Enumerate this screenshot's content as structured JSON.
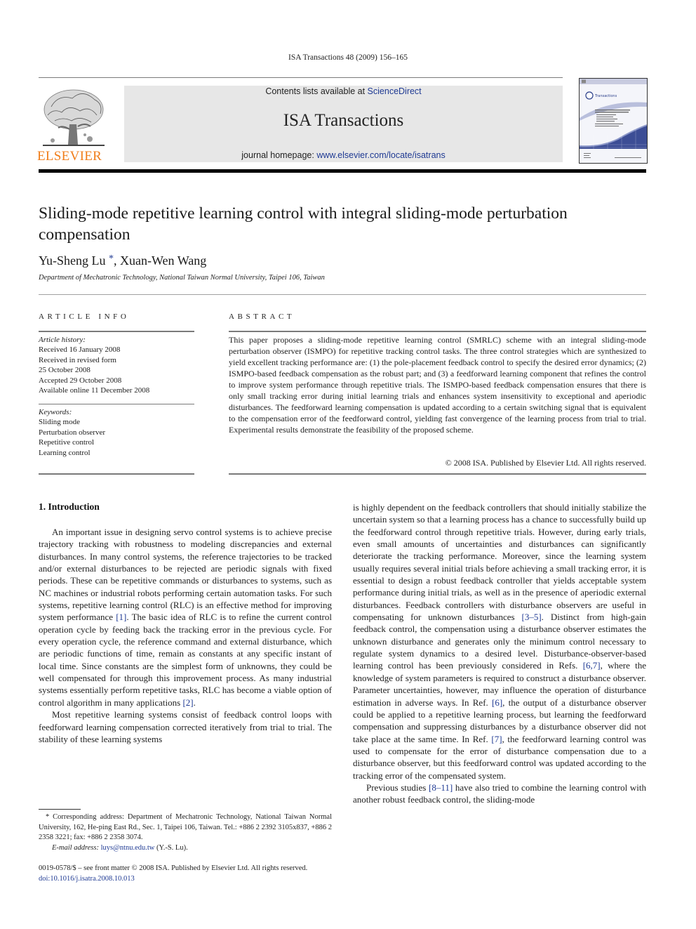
{
  "header": {
    "running_head": "ISA Transactions 48 (2009) 156–165",
    "publisher_wordmark": "ELSEVIER",
    "contents_prefix": "Contents lists available at ",
    "contents_link": "ScienceDirect",
    "journal_name": "ISA Transactions",
    "homepage_prefix": "journal homepage: ",
    "homepage_link": "www.elsevier.com/locate/isatrans",
    "cover": {
      "masthead": "Transactions",
      "tagline": "The Science and Engineering of Measurement and Automation"
    },
    "brand_color": "#f07d1a",
    "link_color": "#1f3a93"
  },
  "article": {
    "title": "Sliding-mode repetitive learning control with integral sliding-mode perturbation compensation",
    "authors": [
      {
        "name": "Yu-Sheng Lu",
        "mark": "*"
      },
      {
        "name": "Xuan-Wen Wang",
        "mark": ""
      }
    ],
    "author_separator": ", ",
    "affiliation": "Department of Mechatronic Technology, National Taiwan Normal University, Taipei 106, Taiwan"
  },
  "article_info": {
    "heading": "ARTICLE INFO",
    "history_label": "Article history:",
    "history": [
      "Received 16 January 2008",
      "Received in revised form",
      "25 October 2008",
      "Accepted 29 October 2008",
      "Available online 11 December 2008"
    ],
    "keywords_label": "Keywords:",
    "keywords": [
      "Sliding mode",
      "Perturbation observer",
      "Repetitive control",
      "Learning control"
    ]
  },
  "abstract": {
    "heading": "ABSTRACT",
    "text": "This paper proposes a sliding-mode repetitive learning control (SMRLC) scheme with an integral sliding-mode perturbation observer (ISMPO) for repetitive tracking control tasks. The three control strategies which are synthesized to yield excellent tracking performance are: (1) the pole-placement feedback control to specify the desired error dynamics; (2) ISMPO-based feedback compensation as the robust part; and (3) a feedforward learning component that refines the control to improve system performance through repetitive trials. The ISMPO-based feedback compensation ensures that there is only small tracking error during initial learning trials and enhances system insensitivity to exceptional and aperiodic disturbances. The feedforward learning compensation is updated according to a certain switching signal that is equivalent to the compensation error of the feedforward control, yielding fast convergence of the learning process from trial to trial. Experimental results demonstrate the feasibility of the proposed scheme.",
    "copyright": "© 2008 ISA. Published by Elsevier Ltd. All rights reserved."
  },
  "body": {
    "section_heading": "1.  Introduction",
    "left_p1": {
      "a": "An important issue in designing servo control systems is to achieve precise trajectory tracking with robustness to modeling discrepancies and external disturbances. In many control systems, the reference trajectories to be tracked and/or external disturbances to be rejected are periodic signals with fixed periods. These can be repetitive commands or disturbances to systems, such as NC machines or industrial robots performing certain automation tasks. For such systems, repetitive learning control (RLC) is an effective method for improving system performance ",
      "ref1": "[1]",
      "b": ". The basic idea of RLC is to refine the current control operation cycle by feeding back the tracking error in the previous cycle. For every operation cycle, the reference command and external disturbance, which are periodic functions of time, remain as constants at any specific instant of local time. Since constants are the simplest form of unknowns, they could be well compensated for through this improvement process. As many industrial systems essentially perform repetitive tasks, RLC has become a viable option of control algorithm in many applications ",
      "ref2": "[2]",
      "c": "."
    },
    "left_p2": "Most repetitive learning systems consist of feedback control loops with feedforward learning compensation corrected iteratively from trial to trial. The stability of these learning systems",
    "right_p1": {
      "a": "is highly dependent on the feedback controllers that should initially stabilize the uncertain system so that a learning process has a chance to successfully build up the feedforward control through repetitive trials. However, during early trials, even small amounts of uncertainties and disturbances can significantly deteriorate the tracking performance. Moreover, since the learning system usually requires several initial trials before achieving a small tracking error, it is essential to design a robust feedback controller that yields acceptable system performance during initial trials, as well as in the presence of aperiodic external disturbances. Feedback controllers with disturbance observers are useful in compensating for unknown disturbances ",
      "ref1": "[3–5]",
      "b": ". Distinct from high-gain feedback control, the compensation using a disturbance observer estimates the unknown disturbance and generates only the minimum control necessary to regulate system dynamics to a desired level. Disturbance-observer-based learning control has been previously considered in Refs. ",
      "ref2": "[6,7]",
      "c": ", where the knowledge of system parameters is required to construct a disturbance observer. Parameter uncertainties, however, may influence the operation of disturbance estimation in adverse ways. In Ref. ",
      "ref3": "[6]",
      "d": ", the output of a disturbance observer could be applied to a repetitive learning process, but learning the feedforward compensation and suppressing disturbances by a disturbance observer did not take place at the same time. In Ref. ",
      "ref4": "[7]",
      "e": ", the feedforward learning control was used to compensate for the error of disturbance compensation due to a disturbance observer, but this feedforward control was updated according to the tracking error of the compensated system."
    },
    "right_p2": {
      "a": "Previous studies ",
      "ref1": "[8–11]",
      "b": " have also tried to combine the learning control with another robust feedback control, the sliding-mode"
    }
  },
  "footnote": {
    "mark": "*",
    "text": " Corresponding address: Department of Mechatronic Technology, National Taiwan Normal University, 162, He-ping East Rd., Sec. 1, Taipei 106, Taiwan. Tel.: +886 2 2392 3105x837, +886 2 2358 3221; fax: +886 2 2358 3074.",
    "email_label": "E-mail address:",
    "email": "luys@ntnu.edu.tw",
    "email_suffix": " (Y.-S. Lu)."
  },
  "front_matter": {
    "issn_line": "0019-0578/$ – see front matter © 2008 ISA. Published by Elsevier Ltd. All rights reserved.",
    "doi": "doi:10.1016/j.isatra.2008.10.013"
  }
}
